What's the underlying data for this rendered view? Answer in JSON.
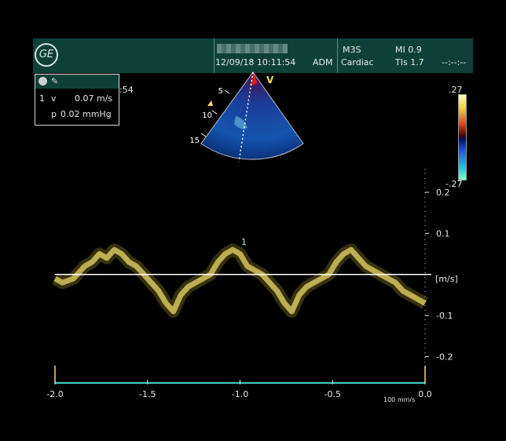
{
  "header": {
    "datetime": "12/09/18 10:11:54",
    "operator": "ADM",
    "probe": "M3S",
    "application": "Cardiac",
    "mi": "MI 0.9",
    "tis": "TIs 1.7",
    "status": "--:--:--"
  },
  "measure": {
    "index": "1",
    "v_label": "v",
    "v_value": "0.07 m/s",
    "p_label": "p",
    "p_value": "0.02 mmHg",
    "clipped_time": ":54"
  },
  "color_scale": {
    "top": ".27",
    "bottom": "-.27"
  },
  "sector": {
    "depth_ticks": [
      "5",
      "10",
      "15"
    ],
    "marker": "V"
  },
  "doppler": {
    "marker": "1",
    "unit_label": "[m/s]",
    "sweep_speed": "100 mm/s"
  },
  "colors": {
    "trace": "#f0e27a",
    "baseline": "#ffffff",
    "header": "#0f4038",
    "axis": "#3fd0c8"
  },
  "chart_data": {
    "type": "line",
    "title": "",
    "xlabel": "",
    "ylabel": "[m/s]",
    "xlim": [
      -2.0,
      0.0
    ],
    "ylim": [
      -0.22,
      0.2
    ],
    "x_ticks": [
      "-2.0",
      "-1.5",
      "-1.0",
      "-0.5",
      "0.0"
    ],
    "y_ticks": [
      "0.2",
      "0.1",
      "-0.1",
      "-0.2"
    ],
    "baseline": 0.0,
    "series": [
      {
        "x": [
          -2.0,
          -1.96,
          -1.9,
          -1.84,
          -1.8,
          -1.76,
          -1.72,
          -1.68,
          -1.64,
          -1.6,
          -1.56,
          -1.52,
          -1.48,
          -1.44,
          -1.4,
          -1.36,
          -1.32,
          -1.28,
          -1.24,
          -1.2,
          -1.16,
          -1.12,
          -1.08,
          -1.04,
          -1.0,
          -0.96,
          -0.92,
          -0.88,
          -0.84,
          -0.8,
          -0.76,
          -0.72,
          -0.68,
          -0.64,
          -0.6,
          -0.56,
          -0.52,
          -0.48,
          -0.44,
          -0.4,
          -0.36,
          -0.32,
          -0.28,
          -0.24,
          -0.2,
          -0.16,
          -0.12,
          -0.08,
          -0.04,
          0.0
        ],
        "values": [
          -0.01,
          -0.02,
          -0.01,
          0.02,
          0.03,
          0.05,
          0.04,
          0.06,
          0.05,
          0.03,
          0.02,
          0.0,
          -0.02,
          -0.04,
          -0.07,
          -0.09,
          -0.05,
          -0.03,
          -0.02,
          -0.01,
          0.0,
          0.03,
          0.05,
          0.06,
          0.05,
          0.02,
          0.01,
          0.0,
          -0.02,
          -0.04,
          -0.07,
          -0.09,
          -0.05,
          -0.03,
          -0.02,
          -0.01,
          0.0,
          0.03,
          0.05,
          0.06,
          0.04,
          0.02,
          0.01,
          0.0,
          -0.01,
          -0.02,
          -0.04,
          -0.05,
          -0.06,
          -0.07
        ]
      }
    ]
  }
}
